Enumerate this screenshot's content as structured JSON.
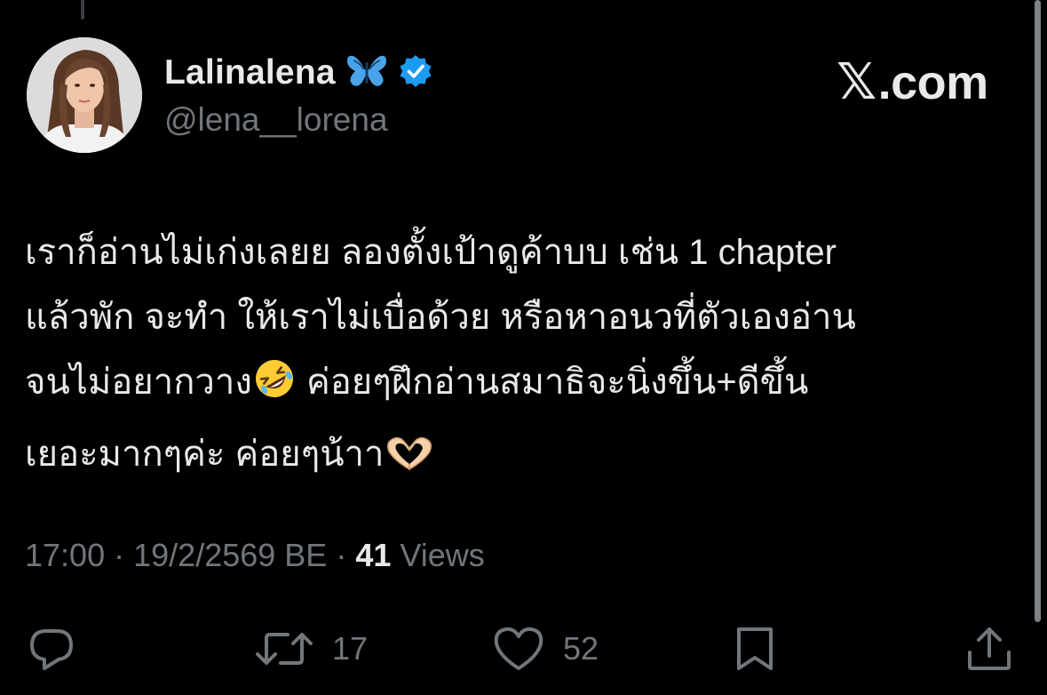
{
  "author": {
    "display_name": "Lalinalena",
    "handle": "@lena__lorena",
    "name_emoji": "butterfly",
    "verified_icon": "verified-badge-icon",
    "verified_color": "#1d9bf0"
  },
  "brand": {
    "x_glyph": "𝕏",
    "domain": ".com"
  },
  "tweet": {
    "lines": [
      "เราก็อ่านไม่เก่งเลยย ลองตั้งเป้าดูค้าบบ เช่น 1 chapter",
      "แล้วพัก จะทำ ให้เราไม่เบื่อด้วย หรือหาอนวที่ตัวเองอ่าน",
      "จนไม่อยากวาง",
      "ค่อยๆฝึกอ่านสมาธิจะนิ่งขึ้น+ดีขึ้น",
      "เยอะมากๆค่ะ ค่อยๆน้าา"
    ],
    "emojis": [
      "rolling-on-floor-laughing",
      "heart-hands"
    ]
  },
  "meta": {
    "time": "17:00",
    "separator": "·",
    "date": "19/2/2569 BE",
    "views_count": "41",
    "views_label": "Views"
  },
  "actions": {
    "reply_icon": "reply-icon",
    "retweet_icon": "retweet-icon",
    "retweet_count": "17",
    "like_icon": "heart-icon",
    "like_count": "52",
    "bookmark_icon": "bookmark-icon",
    "share_icon": "share-icon"
  },
  "colors": {
    "background": "#000000",
    "text_primary": "#e7e9ea",
    "text_secondary": "#71767b",
    "accent": "#1d9bf0"
  }
}
